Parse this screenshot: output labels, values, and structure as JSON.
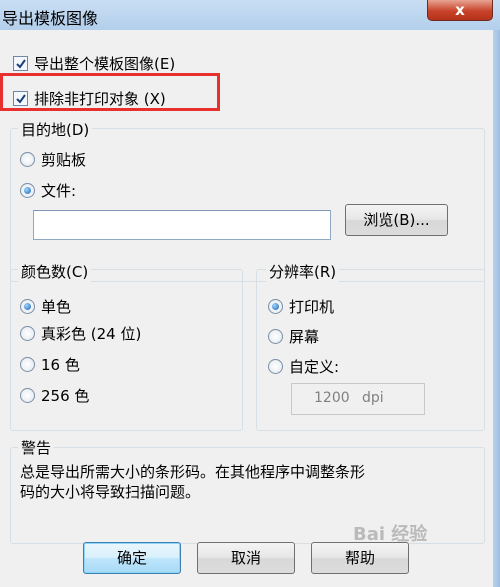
{
  "window": {
    "title": "导出模板图像",
    "close_glyph": "x"
  },
  "options": {
    "export_whole": {
      "label": "导出整个模板图像(E)",
      "checked": true
    },
    "exclude_nonprint": {
      "label": "排除非打印对象 (X)",
      "checked": true
    }
  },
  "destination": {
    "legend": "目的地(D)",
    "clipboard_label": "剪贴板",
    "file_label": "文件:",
    "file_value": "",
    "browse_label": "浏览(B)..."
  },
  "colors": {
    "legend": "颜色数(C)",
    "items": [
      "单色",
      "真彩色 (24 位)",
      "16 色",
      "256 色"
    ],
    "selected": 0
  },
  "resolution": {
    "legend": "分辨率(R)",
    "items": [
      "打印机",
      "屏幕",
      "自定义:"
    ],
    "selected": 0,
    "dpi_value": "1200",
    "dpi_unit": "dpi"
  },
  "warning": {
    "legend": "警告",
    "line1": "总是导出所需大小的条形码。在其他程序中调整条形",
    "line2": "码的大小将导致扫描问题。"
  },
  "buttons": {
    "ok": "确定",
    "cancel": "取消",
    "help": "帮助"
  },
  "watermark": "Bai 经验",
  "accent": {
    "highlight": "#e8312f",
    "default_button": "#3c7fb1"
  }
}
